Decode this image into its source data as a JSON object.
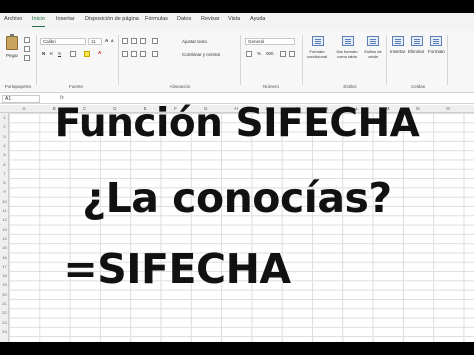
{
  "tabs": [
    "Archivo",
    "Inicio",
    "Insertar",
    "Disposición de página",
    "Fórmulas",
    "Datos",
    "Revisar",
    "Vista",
    "Ayuda"
  ],
  "ribbon": {
    "paste_label": "Pegar",
    "clipboard_label": "Portapapeles",
    "font_name": "Calibri",
    "font_size": "11",
    "font_label": "Fuente",
    "wrap_text": "Ajustar texto",
    "merge_center": "Combinar y centrar",
    "alignment_label": "Alineación",
    "number_format": "General",
    "number_label": "Número",
    "conditional_format": "Formato condicional",
    "format_as_table": "Dar formato como tabla",
    "cell_styles": "Estilos de celda",
    "styles_label": "Estilos",
    "insert": "Insertar",
    "delete": "Eliminar",
    "format": "Formato",
    "cells_label": "Celdas"
  },
  "formula_bar": {
    "name_box": "A1",
    "fx": "fx"
  },
  "columns": [
    "A",
    "B",
    "C",
    "D",
    "E",
    "F",
    "G",
    "H",
    "I",
    "J",
    "K",
    "L",
    "M",
    "N",
    "O"
  ],
  "rows": [
    "1",
    "2",
    "3",
    "4",
    "5",
    "6",
    "7",
    "8",
    "9",
    "10",
    "11",
    "12",
    "13",
    "14",
    "15",
    "16",
    "17",
    "18",
    "19",
    "20",
    "21",
    "22",
    "23",
    "24"
  ],
  "overlay": {
    "line1": "Función SIFECHA",
    "line2": "¿La conocías?",
    "line3": "=SIFECHA"
  }
}
